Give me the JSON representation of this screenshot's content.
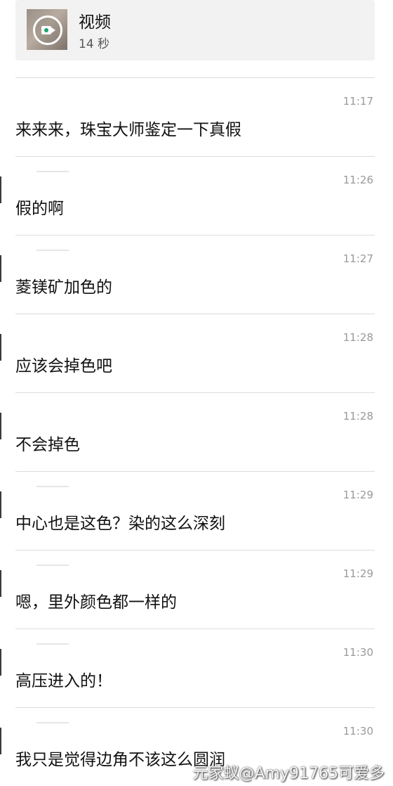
{
  "video_card": {
    "title": "视频",
    "duration": "14 秒"
  },
  "messages": [
    {
      "time": "11:17",
      "text": "来来来，珠宝大师鉴定一下真假"
    },
    {
      "time": "11:26",
      "text": "假的啊"
    },
    {
      "time": "11:27",
      "text": "菱镁矿加色的"
    },
    {
      "time": "11:28",
      "text": "应该会掉色吧"
    },
    {
      "time": "11:28",
      "text": "不会掉色"
    },
    {
      "time": "11:29",
      "text": "中心也是这色？染的这么深刻"
    },
    {
      "time": "11:29",
      "text": "嗯，里外颜色都一样的"
    },
    {
      "time": "11:30",
      "text": "高压进入的！"
    },
    {
      "time": "11:30",
      "text": "我只是觉得边角不该这么圆润"
    }
  ],
  "watermark": {
    "text": "元家蚁@Amy91765可爱多"
  },
  "icons": {
    "video_thumb": "video-camera-icon"
  },
  "colors": {
    "card_bg": "#f2f2f2",
    "time": "#9a9a9a",
    "divider": "#dcdcdc"
  }
}
